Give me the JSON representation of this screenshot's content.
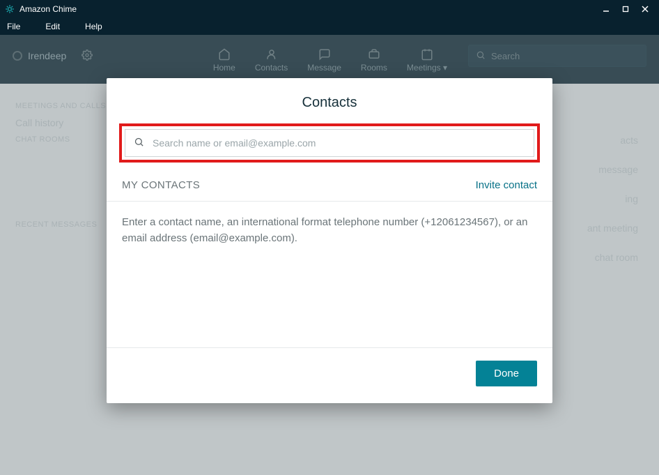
{
  "window": {
    "title": "Amazon Chime"
  },
  "menubar": {
    "file": "File",
    "edit": "Edit",
    "help": "Help"
  },
  "topnav": {
    "username": "Irendeep",
    "links": {
      "home": "Home",
      "contacts": "Contacts",
      "message": "Message",
      "rooms": "Rooms",
      "meetings": "Meetings"
    },
    "search_placeholder": "Search"
  },
  "sidebar": {
    "section1": "MEETINGS AND CALLS",
    "call_history": "Call history",
    "section2": "CHAT ROOMS",
    "section3": "RECENT MESSAGES"
  },
  "bg_right": {
    "contacts": "acts",
    "message": "message",
    "room": "ing",
    "instant": "ant meeting",
    "chatroom": "chat room"
  },
  "modal": {
    "title": "Contacts",
    "search_placeholder": "Search name or email@example.com",
    "my_contacts_label": "MY CONTACTS",
    "invite_label": "Invite contact",
    "help_text": "Enter a contact name, an international format telephone number (+12061234567), or an email address (email@example.com).",
    "done_label": "Done"
  }
}
